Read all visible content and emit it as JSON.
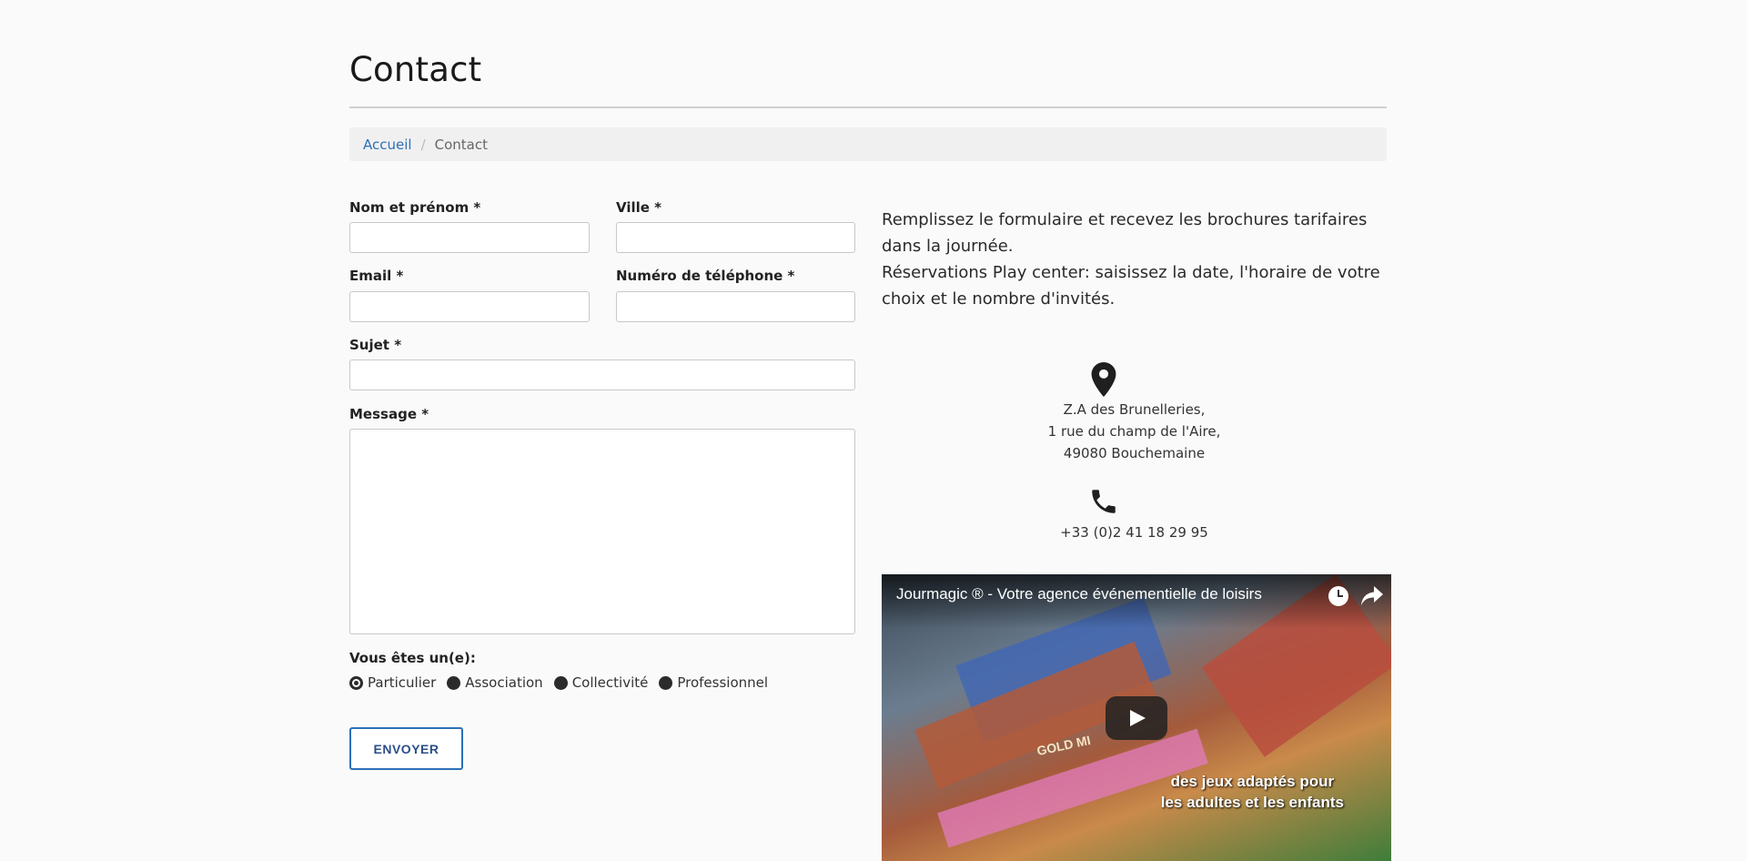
{
  "page": {
    "title": "Contact"
  },
  "breadcrumb": {
    "home": "Accueil",
    "separator": "/",
    "current": "Contact"
  },
  "form": {
    "name_label": "Nom et prénom *",
    "city_label": "Ville *",
    "email_label": "Email *",
    "phone_label": "Numéro de téléphone *",
    "subject_label": "Sujet *",
    "message_label": "Message *",
    "name_value": "",
    "city_value": "",
    "email_value": "",
    "phone_value": "",
    "subject_value": "",
    "message_value": "",
    "type_label": "Vous êtes un(e):",
    "types": [
      "Particulier",
      "Association",
      "Collectivité",
      "Professionnel"
    ],
    "selected_type": "Particulier",
    "submit_label": "ENVOYER"
  },
  "info": {
    "intro_line1": "Remplissez le formulaire et recevez les brochures tarifaires dans la journée.",
    "intro_line2": "Réservations Play center: saisissez la date, l'horaire de votre choix et le nombre d'invités.",
    "address_line1": "Z.A des Brunelleries,",
    "address_line2": "1 rue du champ de l'Aire,",
    "address_line3": "49080 Bouchemaine",
    "phone": "+33 (0)2 41 18 29 95"
  },
  "video": {
    "title": "Jourmagic ® - Votre agence événementielle de loisirs",
    "caption_line1": "des jeux adaptés pour",
    "caption_line2": "les adultes et les enfants",
    "overlay_text": "GOLD MI"
  },
  "icons": {
    "address": "map-pin-icon",
    "phone": "phone-icon",
    "watch_later": "clock-icon",
    "share": "share-icon",
    "play": "play-icon"
  },
  "colors": {
    "link": "#2c6fb8",
    "button_border": "#2c6fb8",
    "button_text": "#2c4f87",
    "background": "#fafafa"
  }
}
